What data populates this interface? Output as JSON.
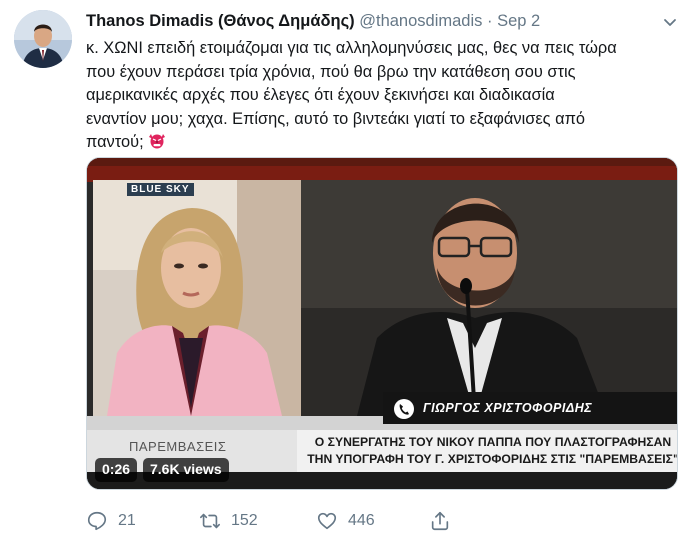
{
  "tweet": {
    "author_name": "Thanos Dimadis (Θάνος Δημάδης)",
    "handle": "@thanosdimadis",
    "separator": "·",
    "date": "Sep 2",
    "lines": [
      "κ. ΧΩΝΙ επειδή ετοιμάζομαι για τις αλληλομηνύσεις μας, θες να πεις τώρα",
      "που έχουν περάσει τρία χρόνια, πού θα βρω την κατάθεση σου στις",
      "αμερικανικές αρχές που έλεγες ότι έχουν ξεκινήσει και διαδικασία",
      "εναντίον μου; χαχα. Επίσης, αυτό το βιντεάκι γιατί το εξαφάνισες από",
      "παντού;"
    ],
    "emoji_icon": "angry-goblin-emoji"
  },
  "video": {
    "brand": "BLUE SKY",
    "caller_name": "ΓΙΩΡΓΟΣ ΧΡΙΣΤΟΦΟΡΙΔΗΣ",
    "program_label": "ΠΑΡΕΜΒΑΣΕΙΣ",
    "headline_line1": "Ο ΣΥΝΕΡΓΑΤΗΣ ΤΟΥ ΝΙΚΟΥ ΠΑΠΠΑ ΠΟΥ ΠΛΑΣΤΟΓΡΑΦΗΣΑΝ",
    "headline_line2": "ΤΗΝ ΥΠΟΓΡΑΦΗ ΤΟΥ Γ. ΧΡΙΣΤΟΦΟΡΙΔΗΣ ΣΤΙΣ \"ΠΑΡΕΜΒΑΣΕΙΣ\"",
    "duration": "0:26",
    "views": "7.6K views"
  },
  "actions": {
    "reply_count": "21",
    "retweet_count": "152",
    "like_count": "446"
  },
  "colors": {
    "text_primary": "#14171a",
    "text_secondary": "#657786",
    "border": "#ccd6dd"
  }
}
